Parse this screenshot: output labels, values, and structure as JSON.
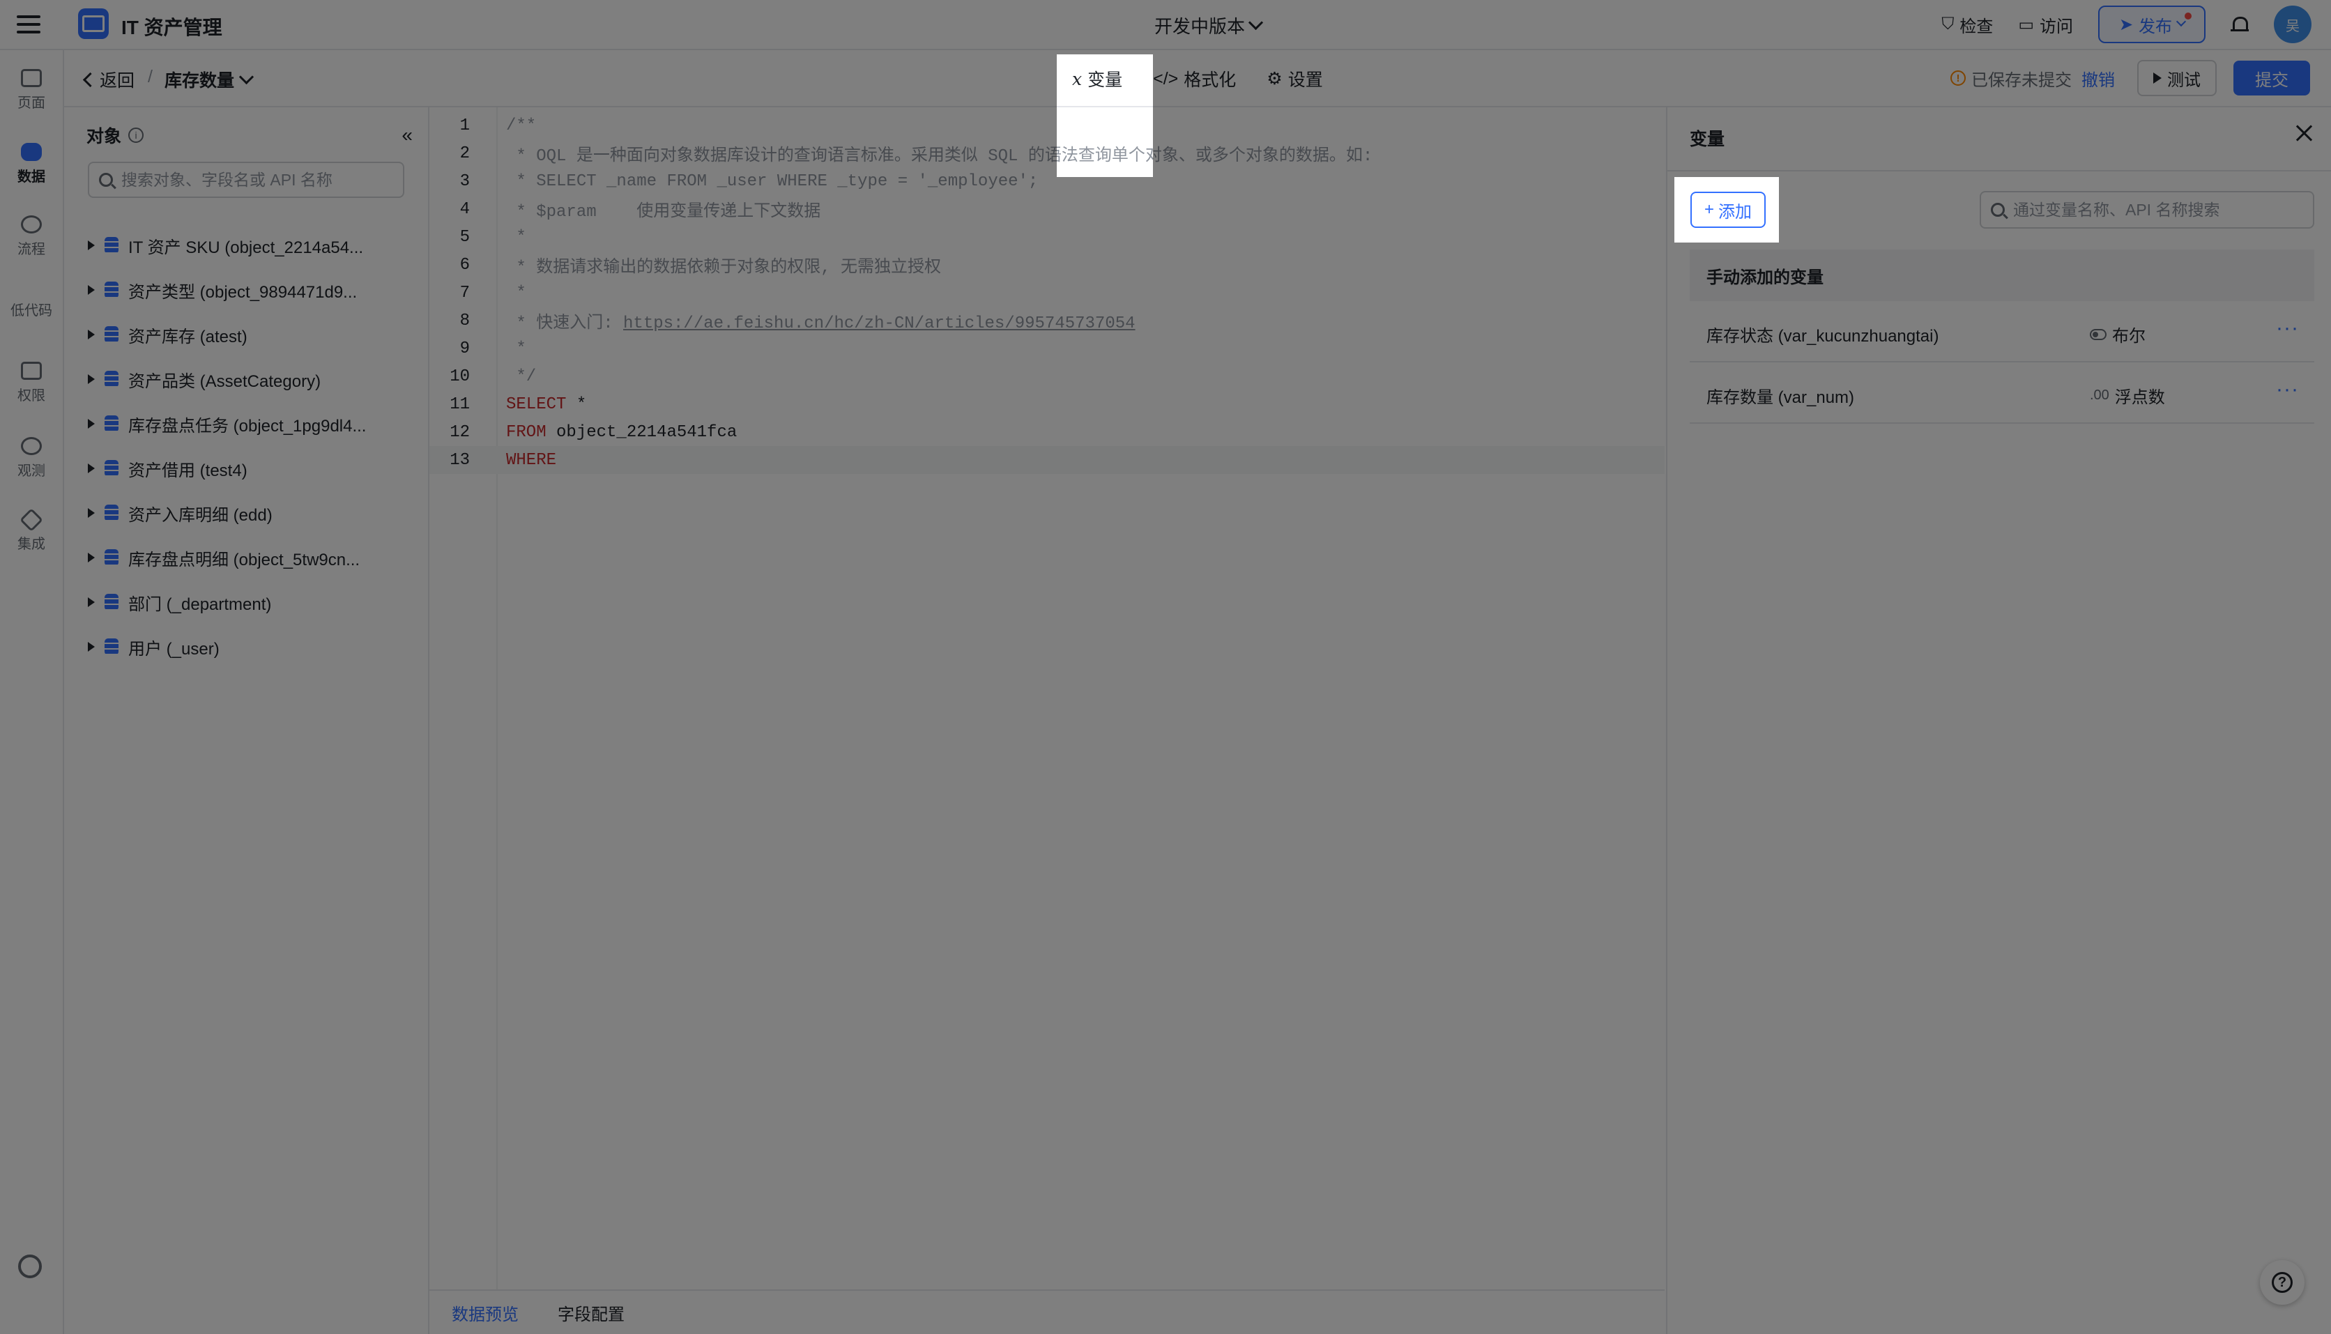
{
  "app": {
    "title": "IT 资产管理",
    "version": "开发中版本",
    "avatar": "吴"
  },
  "topbar": {
    "check": "检查",
    "visit": "访问",
    "publish": "发布"
  },
  "rail": {
    "items": [
      "页面",
      "数据",
      "流程",
      "低代码",
      "权限",
      "观测",
      "集成"
    ],
    "active_index": 1
  },
  "subbar": {
    "back": "返回",
    "separator": "/",
    "current": "库存数量",
    "tabs": [
      {
        "label": "变量",
        "icon": "variable-x-icon"
      },
      {
        "label": "格式化",
        "icon": "code-brackets-icon"
      },
      {
        "label": "设置",
        "icon": "gear-icon"
      }
    ],
    "saved_status": "已保存未提交",
    "undo": "撤销",
    "test": "测试",
    "submit": "提交"
  },
  "objects": {
    "title": "对象",
    "search_placeholder": "搜索对象、字段名或 API 名称",
    "items": [
      "IT 资产 SKU (object_2214a54...",
      "资产类型 (object_9894471d9...",
      "资产库存 (atest)",
      "资产品类 (AssetCategory)",
      "库存盘点任务 (object_1pg9dl4...",
      "资产借用 (test4)",
      "资产入库明细 (edd)",
      "库存盘点明细 (object_5tw9cn...",
      "部门 (_department)",
      "用户 (_user)"
    ]
  },
  "editor": {
    "current_line": 13,
    "lines": [
      {
        "n": "1",
        "text": "/**",
        "style": "comment"
      },
      {
        "n": "2",
        "text": " * OQL 是一种面向对象数据库设计的查询语言标准。采用类似 SQL 的语法查询单个对象、或多个对象的数据。如:",
        "style": "comment"
      },
      {
        "n": "3",
        "text": " * SELECT _name FROM _user WHERE _type = '_employee';",
        "style": "comment"
      },
      {
        "n": "4",
        "text": " * $param    使用变量传递上下文数据",
        "style": "comment"
      },
      {
        "n": "5",
        "text": " *",
        "style": "comment"
      },
      {
        "n": "6",
        "text": " * 数据请求输出的数据依赖于对象的权限, 无需独立授权",
        "style": "comment"
      },
      {
        "n": "7",
        "text": " *",
        "style": "comment"
      },
      {
        "n": "8",
        "text": " * 快速入门: ",
        "style": "comment",
        "link": "https://ae.feishu.cn/hc/zh-CN/articles/995745737054"
      },
      {
        "n": "9",
        "text": " *",
        "style": "comment"
      },
      {
        "n": "10",
        "text": " */",
        "style": "comment"
      },
      {
        "n": "11",
        "kw": "SELECT",
        "rest": " *",
        "style": "kw"
      },
      {
        "n": "12",
        "kw": "FROM",
        "rest": " object_2214a541fca",
        "style": "kw"
      },
      {
        "n": "13",
        "kw": "WHERE",
        "rest": "",
        "style": "kw"
      }
    ]
  },
  "bottom_tabs": [
    "数据预览",
    "字段配置"
  ],
  "variables": {
    "title": "变量",
    "add": "添加",
    "search_placeholder": "通过变量名称、API 名称搜索",
    "group": "手动添加的变量",
    "rows": [
      {
        "name": "库存状态 (var_kucunzhuangtai)",
        "type": "布尔",
        "icon": "toggle-icon"
      },
      {
        "name": "库存数量 (var_num)",
        "type": "浮点数",
        "type_prefix": ".00",
        "icon": "decimal-icon"
      }
    ]
  },
  "colors": {
    "accent": "#3370ff",
    "keyword": "#c5282b",
    "warning": "#ff8800",
    "overlay": "rgba(0,0,0,0.5)"
  }
}
